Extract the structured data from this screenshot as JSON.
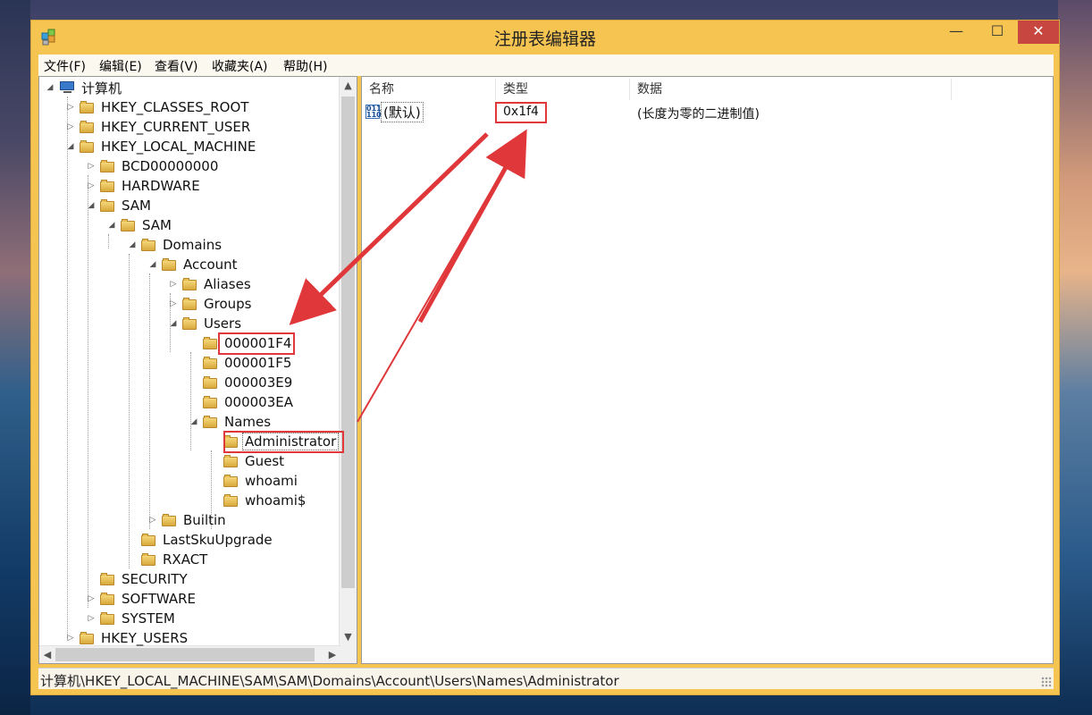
{
  "window": {
    "title": "注册表编辑器",
    "min_label": "—",
    "max_label": "☐",
    "close_label": "✕"
  },
  "menu": [
    "文件(F)",
    "编辑(E)",
    "查看(V)",
    "收藏夹(A)",
    "帮助(H)"
  ],
  "tree": [
    {
      "label": "计算机",
      "expander": "◢",
      "icon": "computer-icon"
    },
    {
      "label": "HKEY_CLASSES_ROOT",
      "expander": "▷"
    },
    {
      "label": "HKEY_CURRENT_USER",
      "expander": "▷"
    },
    {
      "label": "HKEY_LOCAL_MACHINE",
      "expander": "◢"
    },
    {
      "label": "BCD00000000",
      "expander": "▷"
    },
    {
      "label": "HARDWARE",
      "expander": "▷"
    },
    {
      "label": "SAM",
      "expander": "◢"
    },
    {
      "label": "SAM",
      "expander": "◢"
    },
    {
      "label": "Domains",
      "expander": "◢"
    },
    {
      "label": "Account",
      "expander": "◢"
    },
    {
      "label": "Aliases",
      "expander": "▷"
    },
    {
      "label": "Groups",
      "expander": "▷"
    },
    {
      "label": "Users",
      "expander": "◢"
    },
    {
      "label": "000001F4",
      "expander": ""
    },
    {
      "label": "000001F5",
      "expander": ""
    },
    {
      "label": "000003E9",
      "expander": ""
    },
    {
      "label": "000003EA",
      "expander": ""
    },
    {
      "label": "Names",
      "expander": "◢"
    },
    {
      "label": "Administrator",
      "expander": "",
      "selected": true
    },
    {
      "label": "Guest",
      "expander": ""
    },
    {
      "label": "whoami",
      "expander": ""
    },
    {
      "label": "whoami$",
      "expander": ""
    },
    {
      "label": "Builtin",
      "expander": "▷"
    },
    {
      "label": "LastSkuUpgrade",
      "expander": ""
    },
    {
      "label": "RXACT",
      "expander": ""
    },
    {
      "label": "SECURITY",
      "expander": ""
    },
    {
      "label": "SOFTWARE",
      "expander": "▷"
    },
    {
      "label": "SYSTEM",
      "expander": "▷"
    },
    {
      "label": "HKEY_USERS",
      "expander": "▷"
    }
  ],
  "list": {
    "columns": [
      "名称",
      "类型",
      "数据"
    ],
    "rows": [
      {
        "name": "(默认)",
        "type": "0x1f4",
        "data": "(长度为零的二进制值)"
      }
    ]
  },
  "status": {
    "path": "计算机\\HKEY_LOCAL_MACHINE\\SAM\\SAM\\Domains\\Account\\Users\\Names\\Administrator"
  },
  "annotation_color": "#e0383a",
  "icons": {
    "value": "binary-value-icon",
    "scroll_up": "▲",
    "scroll_down": "▼",
    "scroll_left": "◀",
    "scroll_right": "▶"
  }
}
